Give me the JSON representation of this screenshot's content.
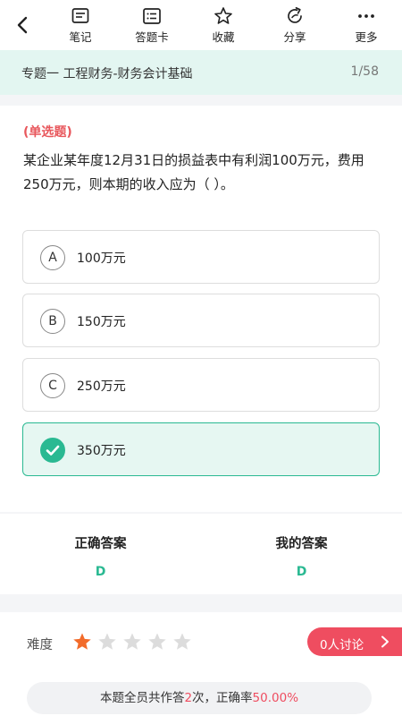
{
  "toolbar": {
    "items": [
      {
        "label": "笔记",
        "icon": "notes-icon"
      },
      {
        "label": "答题卡",
        "icon": "answer-card-icon"
      },
      {
        "label": "收藏",
        "icon": "star-outline-icon"
      },
      {
        "label": "分享",
        "icon": "share-icon"
      },
      {
        "label": "更多",
        "icon": "more-dots-icon"
      }
    ]
  },
  "topic": {
    "title": "专题一 工程财务-财务会计基础",
    "progress": "1/58"
  },
  "question": {
    "type": "(单选题)",
    "text": "某企业某年度12月31日的损益表中有利润100万元，费用250万元，则本期的收入应为（ ）。",
    "options": [
      {
        "key": "A",
        "text": "100万元",
        "selected": false
      },
      {
        "key": "B",
        "text": "150万元",
        "selected": false
      },
      {
        "key": "C",
        "text": "250万元",
        "selected": false
      },
      {
        "key": "D",
        "text": "350万元",
        "selected": true
      }
    ]
  },
  "answers": {
    "correct_label": "正确答案",
    "correct_value": "D",
    "mine_label": "我的答案",
    "mine_value": "D"
  },
  "difficulty": {
    "label": "难度",
    "rating": 1,
    "max": 5,
    "discuss_label": "0人讨论"
  },
  "stats": {
    "prefix": "本题全员共作答",
    "count": "2",
    "mid": "次，正确率",
    "rate": "50.00%"
  },
  "colors": {
    "accent": "#2ab992",
    "topic_bg": "#e3f6f1",
    "danger": "#ef4d60",
    "star_active": "#f26b2a",
    "star_inactive": "#dcdcdc"
  }
}
